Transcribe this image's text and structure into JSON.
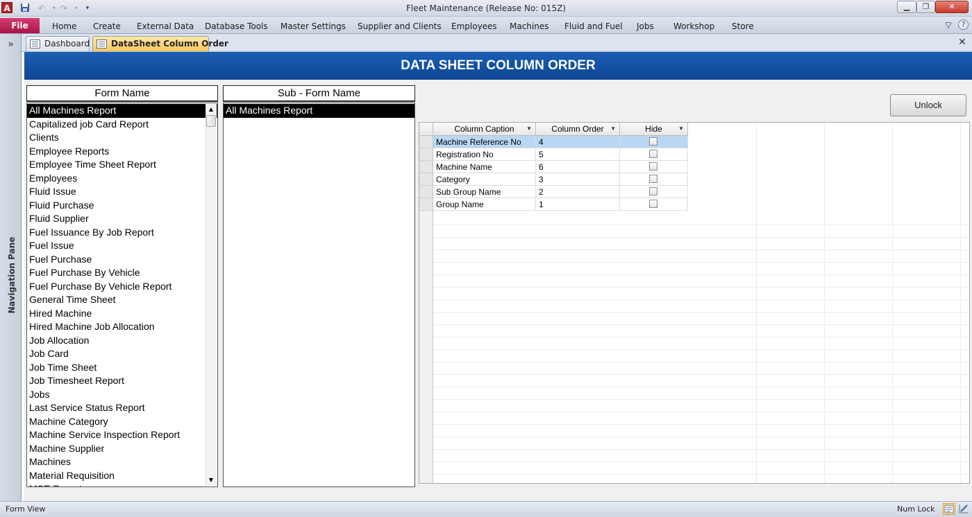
{
  "window": {
    "title": "Fleet Maintenance (Release No: 015Z)",
    "app_icon": "A",
    "buttons": {
      "minimize": "▁",
      "maximize": "❐",
      "close": "✕"
    }
  },
  "quick_access": {
    "save_icon": "save-icon",
    "undo_icon": "undo-icon",
    "redo_icon": "redo-icon",
    "customize_icon": "customize-qat-icon"
  },
  "ribbon": {
    "file": "File",
    "tabs": [
      "Home",
      "Create",
      "External Data",
      "Database Tools",
      "Master Settings",
      "Supplier and Clients",
      "Employees",
      "Machines",
      "Fluid and Fuel",
      "Jobs",
      "Workshop",
      "Store"
    ],
    "minimize_icon": "▽",
    "help_icon": "?"
  },
  "nav_pane": {
    "label": "Navigation Pane",
    "toggle": "»"
  },
  "doc_tabs": [
    {
      "label": "Dashboard"
    },
    {
      "label": "DataSheet Column Order"
    }
  ],
  "doc_close": "✕",
  "form": {
    "title": "DATA SHEET COLUMN ORDER",
    "form_name_header": "Form Name",
    "sub_form_name_header": "Sub - Form Name",
    "form_names": [
      "All Machines Report",
      "Capitalized job Card Report",
      "Clients",
      "Employee Reports",
      "Employee Time Sheet Report",
      "Employees",
      "Fluid Issue",
      "Fluid Purchase",
      "Fluid Supplier",
      "Fuel Issuance By Job Report",
      "Fuel Issue",
      "Fuel Purchase",
      "Fuel Purchase By Vehicle",
      "Fuel Purchase By Vehicle Report",
      "General Time Sheet",
      "Hired Machine",
      "Hired Machine Job Allocation",
      "Job Allocation",
      "Job Card",
      "Job Time Sheet",
      "Job Timesheet Report",
      "Jobs",
      "Last Service Status Report",
      "Machine Category",
      "Machine Service Inspection Report",
      "Machine Supplier",
      "Machines",
      "Material Requisition",
      "MSE Report"
    ],
    "selected_form_name": "All Machines Report",
    "sub_form_names": [
      "All Machines Report"
    ],
    "selected_sub_form_name": "All Machines Report",
    "unlock_label": "Unlock",
    "grid": {
      "columns": [
        "Column Caption",
        "Column Order",
        "Hide"
      ],
      "rows": [
        {
          "caption": "Machine Reference No",
          "order": "4",
          "hide": false
        },
        {
          "caption": "Registration No",
          "order": "5",
          "hide": false
        },
        {
          "caption": "Machine Name",
          "order": "6",
          "hide": false
        },
        {
          "caption": "Category",
          "order": "3",
          "hide": false
        },
        {
          "caption": "Sub Group Name",
          "order": "2",
          "hide": false
        },
        {
          "caption": "Group Name",
          "order": "1",
          "hide": false
        }
      ]
    }
  },
  "status_bar": {
    "left": "Form View",
    "right": "Num Lock"
  }
}
